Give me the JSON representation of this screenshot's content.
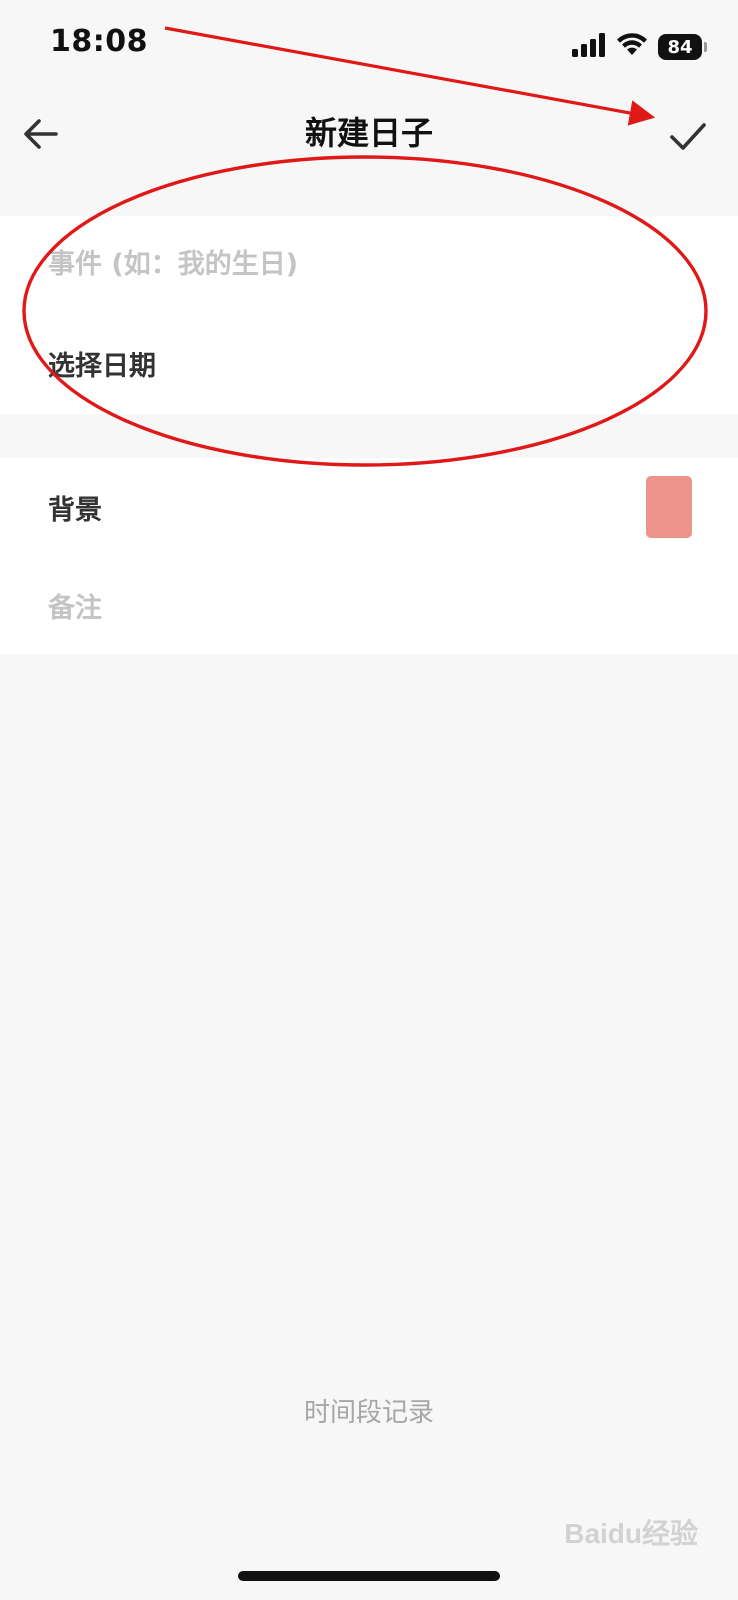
{
  "status_bar": {
    "time": "18:08",
    "battery": "84",
    "signal_icon": "cellular-signal-icon",
    "wifi_icon": "wifi-icon"
  },
  "nav": {
    "title": "新建日子",
    "back_icon": "arrow-left-icon",
    "confirm_icon": "checkmark-icon"
  },
  "form": {
    "event_placeholder": "事件 (如：我的生日)",
    "event_value": "",
    "date_label": "选择日期",
    "background_label": "背景",
    "background_color": "#ec948a",
    "note_placeholder": "备注"
  },
  "footer": {
    "period_record": "时间段记录"
  },
  "watermark": {
    "text": "Baidu经验"
  },
  "colors": {
    "annotation_red": "#e01818",
    "page_bg": "#f7f7f7"
  }
}
